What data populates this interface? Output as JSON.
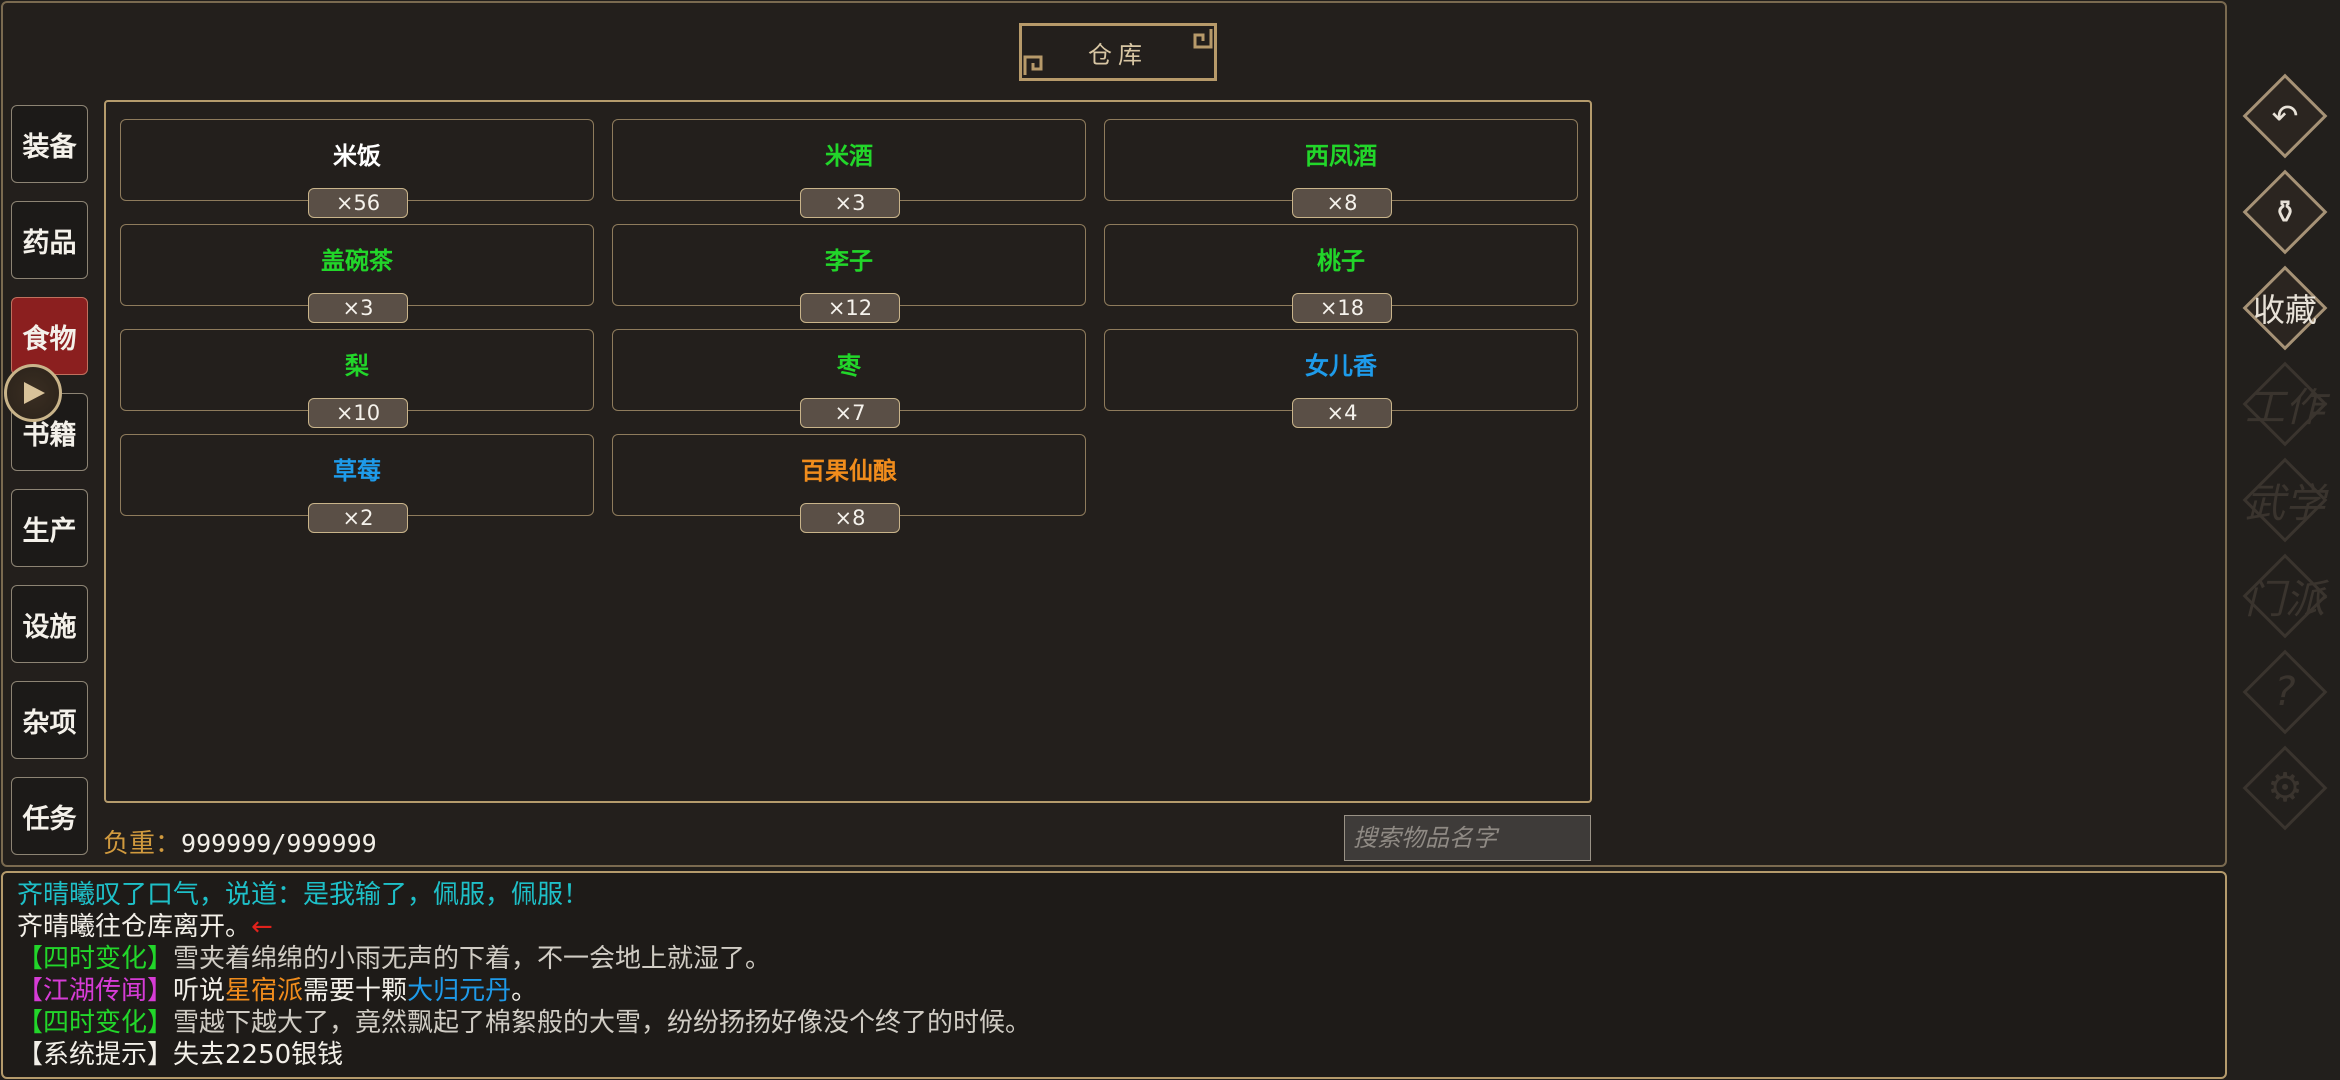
{
  "title": "仓库",
  "categories": [
    {
      "label": "装备",
      "active": false
    },
    {
      "label": "药品",
      "active": false
    },
    {
      "label": "食物",
      "active": true
    },
    {
      "label": "书籍",
      "active": false
    },
    {
      "label": "生产",
      "active": false
    },
    {
      "label": "设施",
      "active": false
    },
    {
      "label": "杂项",
      "active": false
    },
    {
      "label": "任务",
      "active": false
    }
  ],
  "items": [
    {
      "name": "米饭",
      "qty": "×56",
      "color": "#ffffff"
    },
    {
      "name": "米酒",
      "qty": "×3",
      "color": "#22d62a"
    },
    {
      "name": "西凤酒",
      "qty": "×8",
      "color": "#22d62a"
    },
    {
      "name": "盖碗茶",
      "qty": "×3",
      "color": "#22d62a"
    },
    {
      "name": "李子",
      "qty": "×12",
      "color": "#22d62a"
    },
    {
      "name": "桃子",
      "qty": "×18",
      "color": "#22d62a"
    },
    {
      "name": "梨",
      "qty": "×10",
      "color": "#22d62a"
    },
    {
      "name": "枣",
      "qty": "×7",
      "color": "#22d62a"
    },
    {
      "name": "女儿香",
      "qty": "×4",
      "color": "#1e9bea"
    },
    {
      "name": "草莓",
      "qty": "×2",
      "color": "#1e9bea"
    },
    {
      "name": "百果仙酿",
      "qty": "×8",
      "color": "#f08c1c"
    }
  ],
  "weight": {
    "label": "负重：",
    "value": "999999/999999"
  },
  "search": {
    "placeholder": "搜索物品名字"
  },
  "log": [
    [
      {
        "t": "齐晴曦叹了口气，说道：是我输了，佩服，佩服！",
        "c": "#1ec0c8"
      }
    ],
    [
      {
        "t": "齐晴曦往仓库离开。",
        "c": "#f2efe8"
      },
      {
        "t": "←",
        "c": "#e0221c"
      }
    ],
    [
      {
        "t": "【四时变化】",
        "c": "#22d62a"
      },
      {
        "t": "雪夹着绵绵的小雨无声的下着，不一会地上就湿了。",
        "c": "#d0ccc4"
      }
    ],
    [
      {
        "t": "【江湖传闻】",
        "c": "#d63cd6"
      },
      {
        "t": "听说",
        "c": "#f2efe8"
      },
      {
        "t": "星宿派",
        "c": "#f08c1c"
      },
      {
        "t": "需要十颗",
        "c": "#f2efe8"
      },
      {
        "t": "大归元丹",
        "c": "#1e9bea"
      },
      {
        "t": "。",
        "c": "#f2efe8"
      }
    ],
    [
      {
        "t": "【四时变化】",
        "c": "#22d62a"
      },
      {
        "t": "雪越下越大了，竟然飘起了棉絮般的大雪，纷纷扬扬好像没个终了的时候。",
        "c": "#d0ccc4"
      }
    ],
    [
      {
        "t": "【系统提示】失去2250银钱",
        "c": "#f2efe8"
      }
    ]
  ],
  "side_menu": [
    {
      "icon": "return-icon",
      "glyph": "↶",
      "label": "",
      "dim": false
    },
    {
      "icon": "pouch-icon",
      "glyph": "⚱",
      "label": "",
      "dim": false
    },
    {
      "icon": "collect-icon",
      "glyph": "",
      "label": "收藏",
      "dim": false
    },
    {
      "icon": "work-icon",
      "glyph": "",
      "label": "工作",
      "dim": true
    },
    {
      "icon": "martial-icon",
      "glyph": "",
      "label": "武学",
      "dim": true
    },
    {
      "icon": "sect-icon",
      "glyph": "",
      "label": "门派",
      "dim": true
    },
    {
      "icon": "help-icon",
      "glyph": "?",
      "label": "",
      "dim": true
    },
    {
      "icon": "settings-icon",
      "glyph": "⚙",
      "label": "",
      "dim": true
    }
  ]
}
